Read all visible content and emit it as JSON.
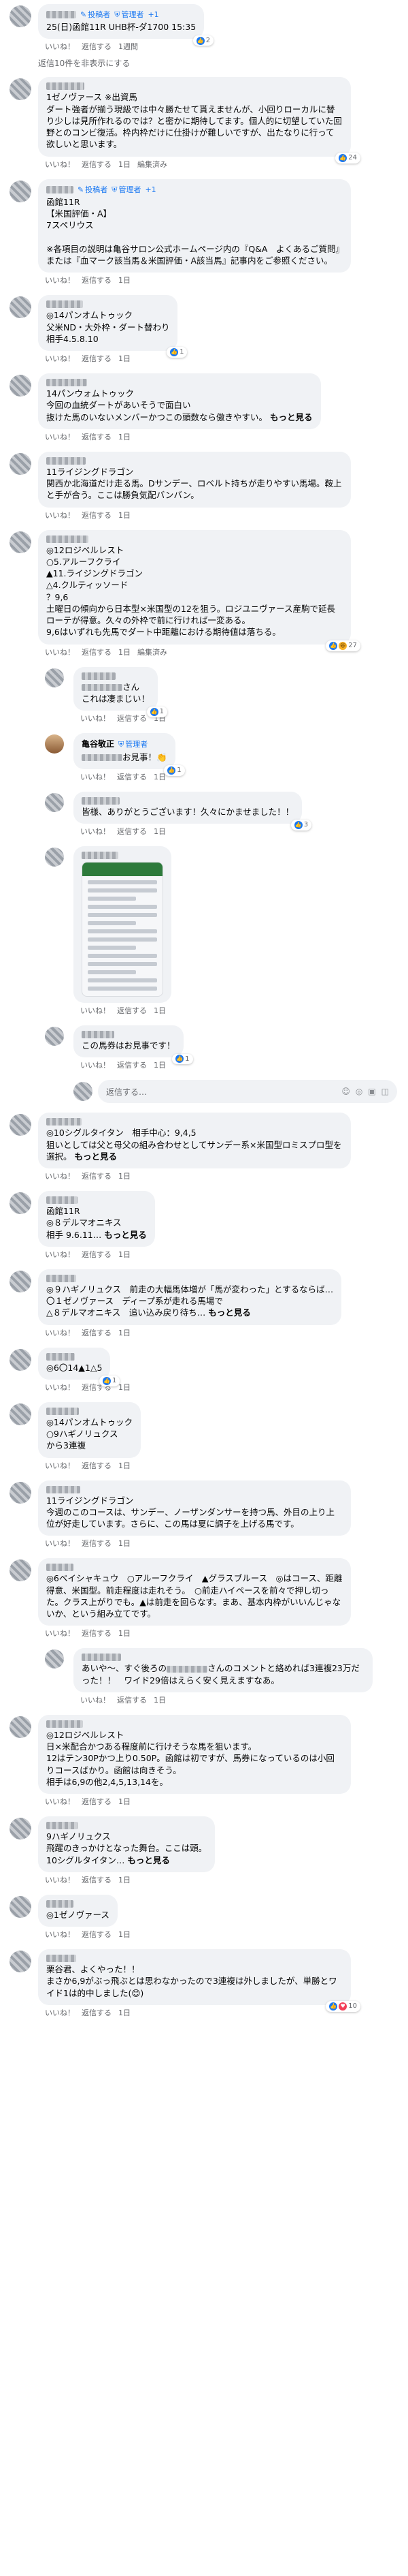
{
  "badges": {
    "poster": "投稿者",
    "admin": "管理者",
    "admin_plus": "+1"
  },
  "actions": {
    "like": "いいね！",
    "reply": "返信する",
    "edit": "編集済み"
  },
  "hidden_replies": "返信10件を非表示にする",
  "compose_placeholder": "返信する…",
  "comments": [
    {
      "level": "top",
      "name_width": 44,
      "tags": "poster_admin",
      "text": "25(日)函館11R UHB杯-ダ1700 15:35",
      "time": "1週間",
      "reaction": {
        "icon": "like",
        "count": "2"
      }
    },
    {
      "level": "top",
      "name_width": 56,
      "tags": "none",
      "text": "1ゼノヴァース ※出資馬\nダート強者が揃う現級では中々勝たせて貰えませんが、小回りローカルに替り少しは見所作れるのでは？と密かに期待してます。個人的に切望していた回野とのコンビ復活。枠内枠だけに仕掛けが難しいですが、出たなりに行って欲しいと思います。",
      "time": "1日",
      "edited": true,
      "reaction": {
        "icon": "like",
        "count": "24"
      }
    },
    {
      "level": "top",
      "name_width": 40,
      "tags": "poster_admin",
      "text": "函館11R\n【米国評価・A】\n7スペリウス\n\n※各項目の説明は亀谷サロン公式ホームページ内の『Q&A　よくあるご質問』または『血マーク該当馬＆米国評価・A該当馬』記事内をご参照ください。",
      "time": "1日"
    },
    {
      "level": "top",
      "name_width": 54,
      "tags": "none",
      "text": "◎14パンオムトゥック\n父米ND・大外枠・ダート替わり\n相手4.5.8.10",
      "time": "1日",
      "reaction": {
        "icon": "like",
        "count": "1"
      }
    },
    {
      "level": "top",
      "name_width": 60,
      "tags": "none",
      "text": "14パンウォムトゥック\n今回の血統ダートがあいそうで面白い\n抜けた馬のいないメンバーかつこの頭数なら傲きやすい。",
      "more": "もっと見る",
      "time": "1日"
    },
    {
      "level": "top",
      "name_width": 58,
      "tags": "none",
      "text": "11ライジングドラゴン\n関西か北海道だけ走る馬。Dサンデー、ロベルト持ちが走りやすい馬場。鞍上と手が合う。ここは勝負気配バンバン。",
      "time": "1日"
    },
    {
      "level": "top",
      "name_width": 62,
      "tags": "none",
      "text": "◎12ロジベルレスト\n○5.アルーフクライ\n▲11.ライジングドラゴン\n△4.クルティッソード\n？9,6\n土曜日の傾向から日本型×米国型の12を狙う。ロジユニヴァース産駒で延長ローテが得意。久々の外枠で前に行ければ一変ある。\n9,6はいずれも先馬でダート中距離における期待値は落ちる。",
      "time": "1日",
      "edited": true,
      "reaction": {
        "icon": "like_haha",
        "count": "27"
      }
    },
    {
      "level": "rep",
      "name_width": 50,
      "tags": "none",
      "mention_pre": true,
      "text": "さん\nこれは凄まじい！",
      "time": "1日",
      "reaction": {
        "icon": "like",
        "count": "1"
      }
    },
    {
      "level": "rep",
      "name": "亀谷敬正",
      "tags": "admin",
      "photo": true,
      "mention_pre": true,
      "text": "お見事！👏",
      "time": "1日",
      "reaction": {
        "icon": "like",
        "count": "1"
      }
    },
    {
      "level": "rep",
      "name_width": 56,
      "tags": "none",
      "text": "皆様、ありがとうございます！久々にかませました！！",
      "time": "1日",
      "reaction": {
        "icon": "like",
        "count": "3"
      }
    },
    {
      "level": "rep",
      "name_width": 54,
      "tags": "none",
      "image": true,
      "text": "",
      "time": "1日"
    },
    {
      "level": "rep",
      "name_width": 48,
      "tags": "none",
      "text": "この馬券はお見事です！",
      "time": "1日",
      "reaction": {
        "icon": "like",
        "count": "1"
      }
    },
    {
      "level": "top",
      "name_width": 52,
      "tags": "none",
      "text": "◎10シグルタイタン　相手中心：9,4,5\n狙いとしては父と母父の組み合わせとしてサンデー系×米国型ロミスプロ型を選択。",
      "more": "もっと見る",
      "time": "1日"
    },
    {
      "level": "top",
      "name_width": 46,
      "tags": "none",
      "text": "函館11R\n◎８デルマオニキス\n相手 9.6.11…",
      "more": "もっと見る",
      "time": "1日"
    },
    {
      "level": "top",
      "name_width": 44,
      "tags": "none",
      "text": "◎９ハギノリュクス　前走の大幅馬体増が「馬が変わった」とするならば…\n〇１ゼノヴァース　ディープ系が走れる馬場で\n△８デルマオニキス　追い込み戻り待ち…",
      "more": "もっと見る",
      "time": "1日"
    },
    {
      "level": "top",
      "name_width": 42,
      "tags": "none",
      "text": "◎6〇14▲1△5",
      "time": "1日",
      "reaction": {
        "icon": "like",
        "count": "1"
      }
    },
    {
      "level": "top",
      "name_width": 48,
      "tags": "none",
      "text": "◎14パンオムトゥック\n○9ハギノリュクス\nから3連複",
      "time": "1日"
    },
    {
      "level": "top",
      "name_width": 50,
      "tags": "none",
      "text": "11ライジングドラゴン\n今週のこのコースは、サンデー、ノーザンダンサーを持つ馬、外目の上り上位が好走しています。さらに、この馬は夏に調子を上げる馬です。",
      "time": "1日"
    },
    {
      "level": "top",
      "name_width": 40,
      "tags": "none",
      "text": "◎6ベイシャキュウ　○アルーフクライ　▲グラスブルース　◎はコース、距離得意、米国型。前走程度は走れそう。　○前走ハイペースを前々で押し切った。クラス上がりでも。▲は前走を回らなす。まあ、基本内枠がいいんじゃないか、という組み立てです。",
      "time": "1日"
    },
    {
      "level": "rep",
      "name_width": 58,
      "tags": "none",
      "text_pre": "あいや～、すぐ後ろの",
      "text_post": "さんのコメントと絡めれば3連複23万だった！！　ワイド29倍はえらく安く見えますなあ。",
      "time": "1日"
    },
    {
      "level": "top",
      "name_width": 54,
      "tags": "none",
      "text": "◎12ロジベルレスト\n日×米配合かつある程度前に行けそうな馬を狙います。\n12はテン30Pかつ上り0.50P。函館は初ですが、馬券になっているのは小回りコースばかり。函館は向きそう。\n相手は6,9の他2,4,5,13,14を。",
      "time": "1日"
    },
    {
      "level": "top",
      "name_width": 46,
      "tags": "none",
      "text": "9ハギノリュクス\n飛躍のきっかけとなった舞台。ここは頭。\n10シグルタイタン…",
      "more": "もっと見る",
      "time": "1日"
    },
    {
      "level": "top",
      "name_width": 40,
      "tags": "none",
      "text": "◎1ゼノヴァース",
      "time": "1日"
    },
    {
      "level": "top",
      "name_width": 44,
      "tags": "none",
      "text": "栗谷君、よくやった！！\nまさか6,9がぶっ飛ぶとは思わなかったので3連複は外しましたが、単勝とワイド1は的中しました(😊)",
      "time": "1日",
      "reaction": {
        "icon": "like_heart",
        "count": "10"
      }
    }
  ]
}
